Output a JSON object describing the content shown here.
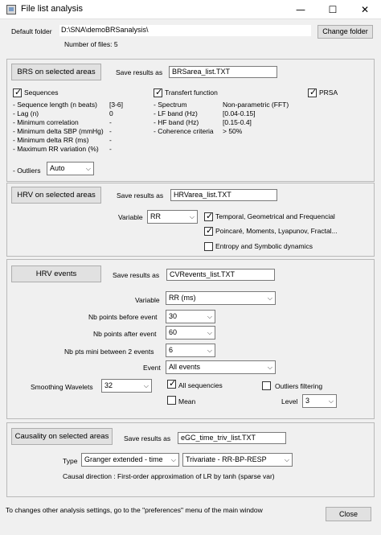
{
  "window": {
    "title": "File list analysis",
    "minimize": "—",
    "maximize": "☐",
    "close": "✕"
  },
  "header": {
    "default_folder_label": "Default folder",
    "default_folder_value": "D:\\SNA\\demoBRSanalysis\\",
    "change_folder": "Change folder",
    "num_files": "Number of files: 5"
  },
  "brs": {
    "button": "BRS on selected areas",
    "save_label": "Save results as",
    "save_value": "BRSarea_list.TXT",
    "sequences": "Sequences",
    "seq_params": [
      {
        "label": "- Sequence length (n beats)",
        "value": "[3-6]"
      },
      {
        "label": "- Lag (n)",
        "value": "0"
      },
      {
        "label": "- Minimum correlation",
        "value": "-"
      },
      {
        "label": "- Minimum delta SBP (mmHg)",
        "value": "-"
      },
      {
        "label": "- Minimum delta RR (ms)",
        "value": "-"
      },
      {
        "label": "- Maximum RR variation (%)",
        "value": "-"
      }
    ],
    "transfer": "Transfert function",
    "tf_params": [
      {
        "label": "- Spectrum",
        "value": "Non-parametric (FFT)"
      },
      {
        "label": "- LF band (Hz)",
        "value": "[0.04-0.15]"
      },
      {
        "label": "- HF band (Hz)",
        "value": "[0.15-0.4]"
      },
      {
        "label": "- Coherence criteria",
        "value": "> 50%"
      }
    ],
    "prsa": "PRSA",
    "outliers_label": "- Outliers",
    "outliers_value": "Auto"
  },
  "hrv": {
    "button": "HRV on selected areas",
    "save_label": "Save results as",
    "save_value": "HRVarea_list.TXT",
    "variable_label": "Variable",
    "variable_value": "RR",
    "opt1": "Temporal, Geometrical and Frequencial",
    "opt2": "Poincaré, Moments, Lyapunov, Fractal...",
    "opt3": "Entropy and Symbolic dynamics"
  },
  "events": {
    "button": "HRV events",
    "save_label": "Save results as",
    "save_value": "CVRevents_list.TXT",
    "variable_label": "Variable",
    "variable_value": "RR (ms)",
    "before_label": "Nb points before event",
    "before_value": "30",
    "after_label": "Nb points after event",
    "after_value": "60",
    "mini_label": "Nb pts mini between 2 events",
    "mini_value": "6",
    "event_label": "Event",
    "event_value": "All events",
    "smooth_label": "Smoothing Wavelets",
    "smooth_value": "32",
    "all_seq": "All sequencies",
    "outliers_filter": "Outliers filtering",
    "mean": "Mean",
    "level_label": "Level",
    "level_value": "3"
  },
  "causality": {
    "button": "Causality on selected areas",
    "save_label": "Save results as",
    "save_value": "eGC_time_triv_list.TXT",
    "type_label": "Type",
    "type_value": "Granger extended - time",
    "type2_value": "Trivariate - RR-BP-RESP",
    "direction": "Causal direction : First-order approximation of LR by tanh (sparse var)"
  },
  "footer": {
    "note": "To changes other analysis settings, go to the \"preferences\" menu of the main window",
    "close": "Close"
  }
}
